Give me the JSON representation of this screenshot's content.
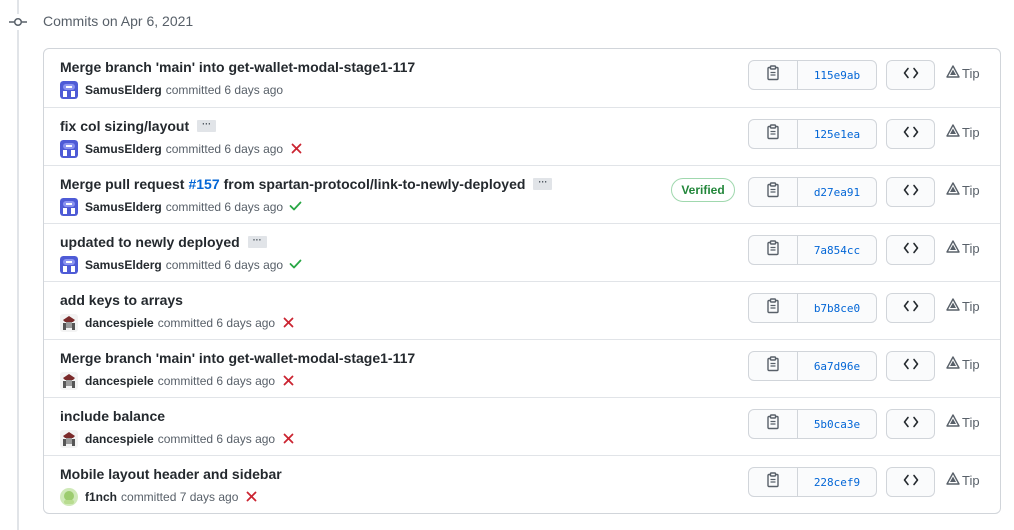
{
  "header": {
    "title": "Commits on Apr 6, 2021"
  },
  "tip_label": "Tip",
  "commits": [
    {
      "title": "Merge branch 'main' into get-wallet-modal-stage1-117",
      "author": "SamusElderg",
      "meta": "committed 6 days ago",
      "sha": "115e9ab",
      "status": "none",
      "ellipsis": false,
      "verified": "",
      "avatar": "samus"
    },
    {
      "title": "fix col sizing/layout",
      "author": "SamusElderg",
      "meta": "committed 6 days ago",
      "sha": "125e1ea",
      "status": "fail",
      "ellipsis": true,
      "verified": "",
      "avatar": "samus"
    },
    {
      "title_pre": "Merge pull request",
      "pr": "#157",
      "title_post": "from spartan-protocol/link-to-newly-deployed",
      "author": "SamusElderg",
      "meta": "committed 6 days ago",
      "sha": "d27ea91",
      "status": "pass",
      "ellipsis": true,
      "verified": "Verified",
      "avatar": "samus"
    },
    {
      "title": "updated to newly deployed",
      "author": "SamusElderg",
      "meta": "committed 6 days ago",
      "sha": "7a854cc",
      "status": "pass",
      "ellipsis": true,
      "verified": "",
      "avatar": "samus"
    },
    {
      "title": "add keys to arrays",
      "author": "dancespiele",
      "meta": "committed 6 days ago",
      "sha": "b7b8ce0",
      "status": "fail",
      "ellipsis": false,
      "verified": "",
      "avatar": "dance"
    },
    {
      "title": "Merge branch 'main' into get-wallet-modal-stage1-117",
      "author": "dancespiele",
      "meta": "committed 6 days ago",
      "sha": "6a7d96e",
      "status": "fail",
      "ellipsis": false,
      "verified": "",
      "avatar": "dance"
    },
    {
      "title": "include balance",
      "author": "dancespiele",
      "meta": "committed 6 days ago",
      "sha": "5b0ca3e",
      "status": "fail",
      "ellipsis": false,
      "verified": "",
      "avatar": "dance"
    },
    {
      "title": "Mobile layout header and sidebar",
      "author": "f1nch",
      "meta": "committed 7 days ago",
      "sha": "228cef9",
      "status": "fail",
      "ellipsis": false,
      "verified": "",
      "avatar": "finch"
    }
  ],
  "colors": {
    "link": "#0366d6",
    "fail": "#cb2431",
    "pass": "#28a745",
    "verified": "#22863a"
  }
}
